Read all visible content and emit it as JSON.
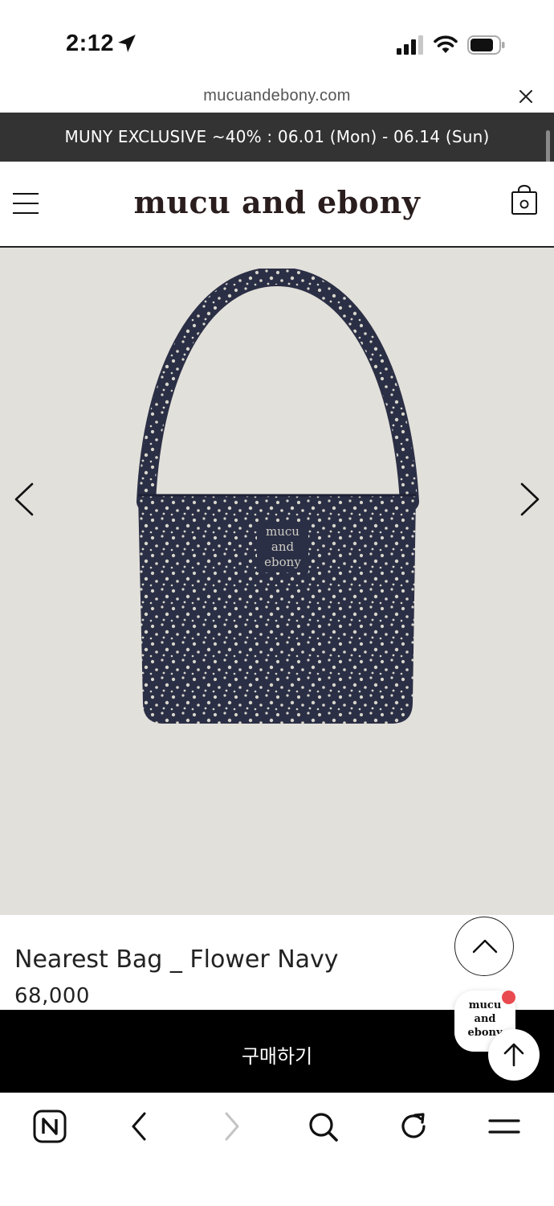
{
  "status_bar": {
    "time": "2:12"
  },
  "url_bar": {
    "url": "mucuandebony.com"
  },
  "promo_banner": {
    "text": "MUNY EXCLUSIVE ~40% : 06.01 (Mon) - 06.14 (Sun)"
  },
  "header": {
    "logo": "mucu and ebony"
  },
  "product": {
    "image_logo_line1": "mucu",
    "image_logo_line2": "and",
    "image_logo_line3": "ebony",
    "name": "Nearest Bag _ Flower Navy",
    "price": "68,000"
  },
  "buy_bar": {
    "label": "구매하기"
  },
  "brand_badge": {
    "text": "mucu\nand\nebony"
  },
  "colors": {
    "promo_bg": "#333333",
    "image_bg": "#e2e0da",
    "bag_navy": "#2b2f45",
    "buy_bg": "#000000",
    "notification_dot": "#e94a4f"
  },
  "icons": {
    "toolbar": [
      "naver-n-icon",
      "back-icon",
      "forward-icon",
      "search-icon",
      "refresh-icon",
      "menu-icon"
    ]
  }
}
